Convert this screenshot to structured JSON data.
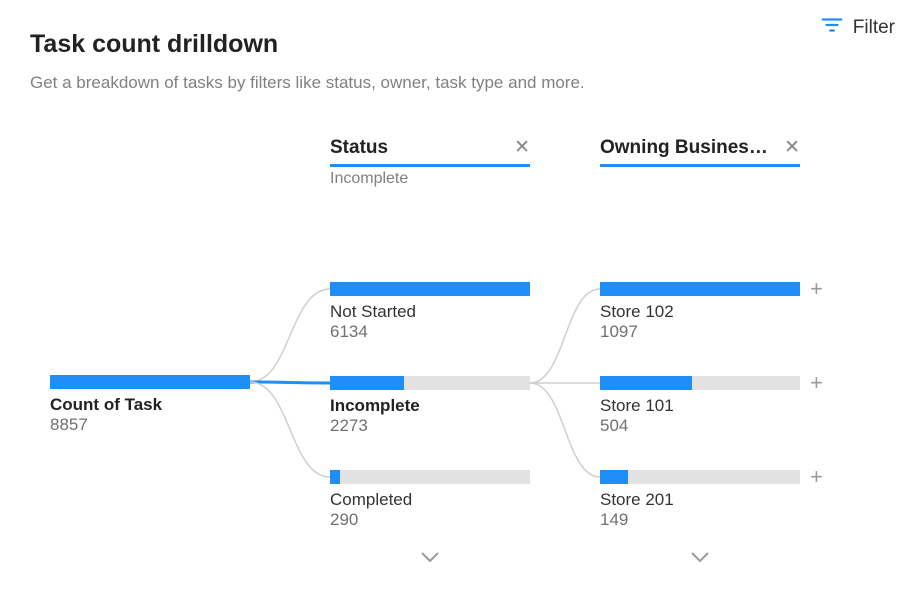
{
  "header": {
    "title": "Task count drilldown",
    "subtitle": "Get a breakdown of tasks by filters like status, owner, task type and more.",
    "filter_label": "Filter"
  },
  "columns": {
    "status": {
      "label": "Status",
      "sublabel": "Incomplete"
    },
    "owning": {
      "label": "Owning Business…"
    }
  },
  "root": {
    "label": "Count of Task",
    "value": "8857"
  },
  "status_nodes": {
    "not_started": {
      "label": "Not Started",
      "value": "6134"
    },
    "incomplete": {
      "label": "Incomplete",
      "value": "2273"
    },
    "completed": {
      "label": "Completed",
      "value": "290"
    }
  },
  "owning_nodes": {
    "store102": {
      "label": "Store 102",
      "value": "1097"
    },
    "store101": {
      "label": "Store 101",
      "value": "504"
    },
    "store201": {
      "label": "Store 201",
      "value": "149"
    }
  },
  "chart_data": {
    "type": "bar",
    "title": "Task count drilldown",
    "root": {
      "name": "Count of Task",
      "value": 8857
    },
    "levels": [
      {
        "dimension": "Status",
        "selected": "Incomplete",
        "items": [
          {
            "name": "Not Started",
            "value": 6134
          },
          {
            "name": "Incomplete",
            "value": 2273
          },
          {
            "name": "Completed",
            "value": 290
          }
        ]
      },
      {
        "dimension": "Owning Business",
        "items": [
          {
            "name": "Store 102",
            "value": 1097
          },
          {
            "name": "Store 101",
            "value": 504
          },
          {
            "name": "Store 201",
            "value": 149
          }
        ]
      }
    ]
  }
}
